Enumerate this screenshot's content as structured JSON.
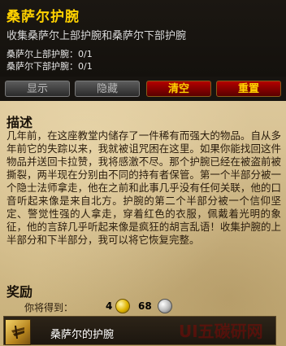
{
  "quest": {
    "title": "桑萨尔护腕",
    "objective": "收集桑萨尔上部护腕和桑萨尔下部护腕",
    "objectives": [
      {
        "text": "桑萨尔上部护腕：0/1"
      },
      {
        "text": "桑萨尔下部护腕：0/1"
      }
    ]
  },
  "buttons": {
    "show": "显示",
    "hide": "隐藏",
    "clear": "清空",
    "reset": "重置"
  },
  "description": {
    "heading": "描述",
    "text": "几年前，在这座教堂内储存了一件稀有而强大的物品。自从多年前它的失踪以来，我就被诅咒困在这里。如果你能找回这件物品并送回卡拉赞，我将感激不尽。那个护腕已经在被盗前被撕裂，两半现在分别由不同的持有者保管。第一个半部分被一个隐士法师拿走，他在之前和此事几乎没有任何关联，他的口音听起来像是来自北方。护腕的第二个半部分被一个信仰坚定、警觉性强的人拿走，穿着红色的衣服，佩戴着光明的象征，他的言辞几乎听起来像是疯狂的胡言乱语！收集护腕的上半部分和下半部分，我可以将它恢复完整。"
  },
  "rewards": {
    "heading": "奖励",
    "you_get": "你将得到：",
    "gold": "4",
    "silver": "68",
    "item_name": "桑萨尔的护腕",
    "colors": {
      "gold_coin": "#e0b400",
      "silver_coin": "#b8b8b8"
    }
  },
  "icons": {
    "item": "bracer-item-icon",
    "gold": "gold-coin-icon",
    "silver": "silver-coin-icon"
  },
  "watermark": "UI五碳研网"
}
